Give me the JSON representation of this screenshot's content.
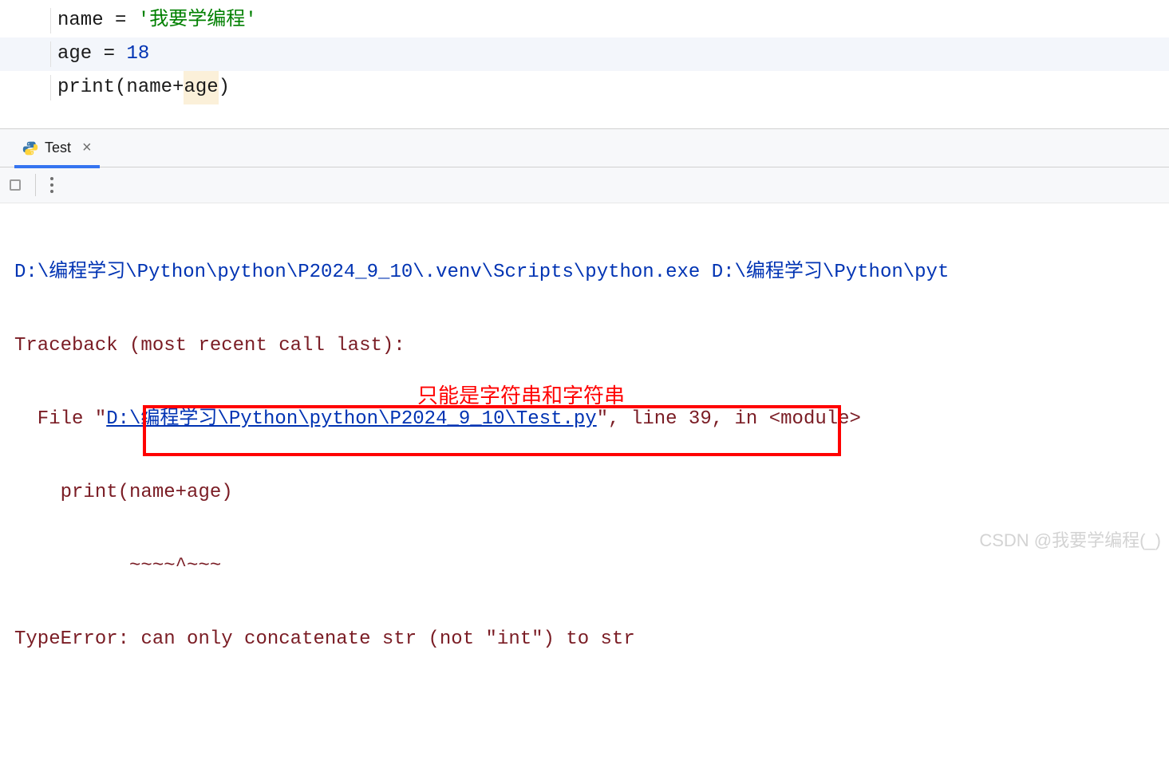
{
  "code": {
    "line1": {
      "var": "name",
      "assign": " = ",
      "str": "'我要学编程'"
    },
    "line2": {
      "var": "age",
      "assign": " = ",
      "num": "18"
    },
    "line3": {
      "func": "print",
      "open": "(",
      "arg1": "name",
      "plus": "+",
      "arg2": "age",
      "close": ")"
    }
  },
  "tab": {
    "label": "Test"
  },
  "console": {
    "exec_line": "D:\\编程学习\\Python\\python\\P2024_9_10\\.venv\\Scripts\\python.exe D:\\编程学习\\Python\\pyt",
    "traceback_header": "Traceback (most recent call last):",
    "file_prefix": "  File \"",
    "file_link": "D:\\编程学习\\Python\\python\\P2024_9_10\\Test.py",
    "file_suffix": "\", line 39, in <module>",
    "code_echo": "    print(name+age)",
    "caret_line": "          ~~~~^~~~",
    "error_label": "TypeError",
    "error_sep": ": ",
    "error_msg": "can only concatenate str (not \"int\") to str"
  },
  "annotation": {
    "label": "只能是字符串和字符串"
  },
  "watermark": "CSDN @我要学编程(_)"
}
